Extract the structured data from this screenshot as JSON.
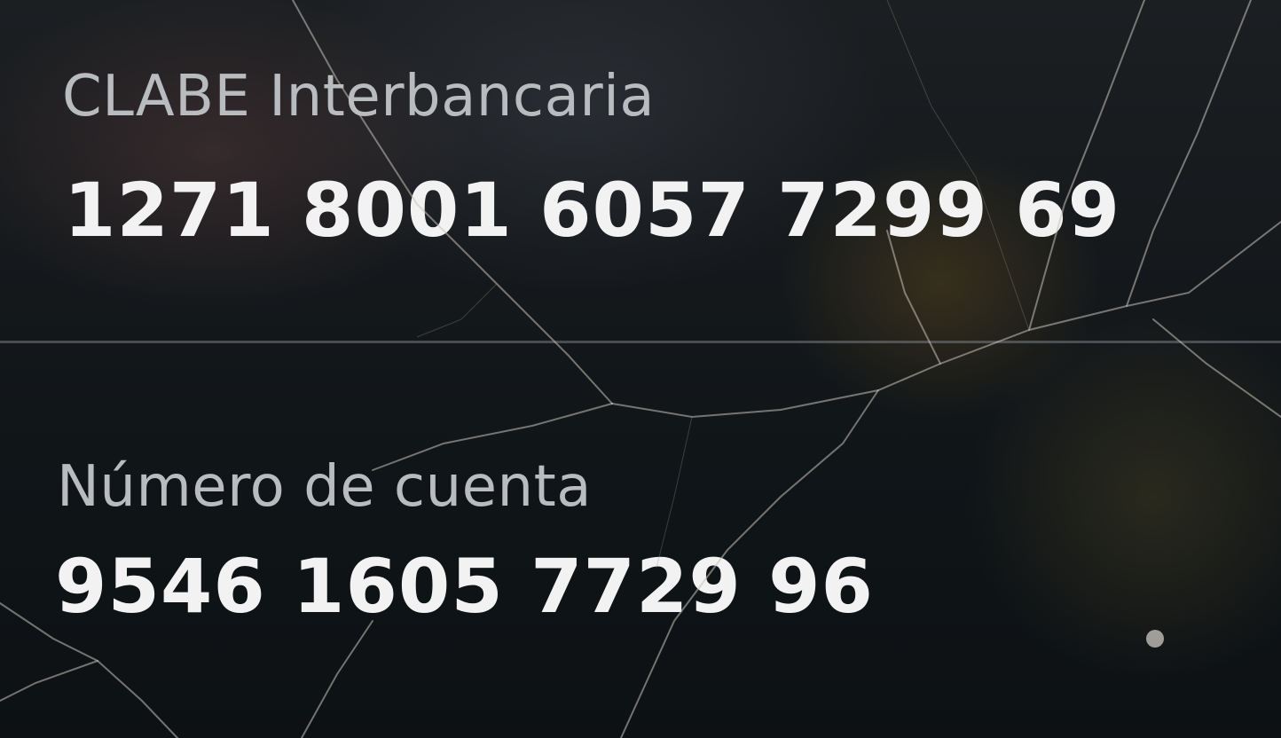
{
  "clabe": {
    "label": "CLABE Interbancaria",
    "number": "1271 8001 6057 7299 69"
  },
  "account": {
    "label": "Número de cuenta",
    "number": "9546 1605 7729 96"
  },
  "colors": {
    "label_text": "#b9bcbf",
    "value_text": "#f2f2f2",
    "background": "#0e1114"
  }
}
